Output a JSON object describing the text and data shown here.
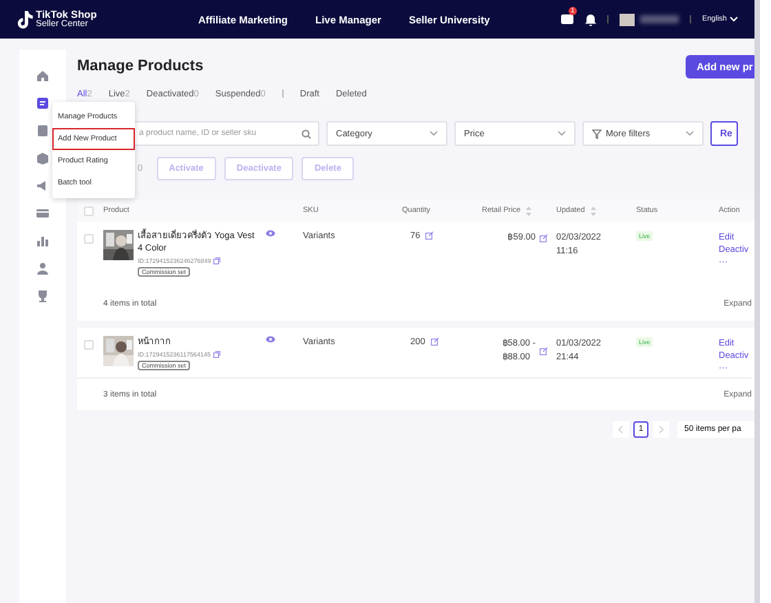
{
  "header": {
    "logo_line1": "TikTok Shop",
    "logo_line2": "Seller Center",
    "nav": [
      "Affiliate Marketing",
      "Live Manager",
      "Seller University"
    ],
    "message_badge": "1",
    "language": "English"
  },
  "sidebar": {
    "items": [
      {
        "selected": false
      },
      {
        "selected": true
      },
      {
        "selected": false
      },
      {
        "selected": false
      },
      {
        "selected": false
      },
      {
        "selected": false
      },
      {
        "selected": false
      },
      {
        "selected": false
      },
      {
        "selected": false
      }
    ]
  },
  "menu": {
    "items": [
      {
        "label": "Manage Products",
        "highlighted": false
      },
      {
        "label": "Add New Product",
        "highlighted": true
      },
      {
        "label": "Product Rating",
        "highlighted": false
      },
      {
        "label": "Batch tool",
        "highlighted": false
      }
    ]
  },
  "page": {
    "title": "Manage Products",
    "add_button": "Add new pr"
  },
  "tabs": [
    {
      "label": "All",
      "count": "2",
      "selected": true
    },
    {
      "label": "Live",
      "count": "2",
      "selected": false
    },
    {
      "label": "Deactivated",
      "count": "0",
      "selected": false
    },
    {
      "label": "Suspended",
      "count": "0",
      "selected": false
    },
    {
      "label": "Draft",
      "selected": false
    },
    {
      "label": "Deleted",
      "selected": false
    }
  ],
  "filters": {
    "search": {
      "placeholder": "a product name, ID or seller sku"
    },
    "selects": [
      {
        "kind": "plain",
        "label": "Category"
      },
      {
        "kind": "plain",
        "label": "Price"
      },
      {
        "kind": "filter",
        "label": "More filters"
      }
    ],
    "reset_button": "Re"
  },
  "bulk": {
    "selected_count": "0",
    "buttons": [
      {
        "label": "Activate",
        "disabled": true
      },
      {
        "label": "Deactivate",
        "disabled": true
      },
      {
        "label": "Delete",
        "disabled": true
      }
    ]
  },
  "table": {
    "select_all": {
      "checked": false
    },
    "columns": [
      {
        "label": "Product",
        "sortable": false
      },
      {
        "label": "SKU",
        "sortable": false
      },
      {
        "label": "Quantity",
        "sortable": false
      },
      {
        "label": "Retail Price",
        "sortable": true
      },
      {
        "label": "Updated",
        "sortable": true
      },
      {
        "label": "Status",
        "sortable": false
      },
      {
        "label": "Action",
        "sortable": false
      }
    ],
    "products": [
      {
        "checked": false,
        "name": "เสื้อสายเดี่ยวครึ่งตัว Yoga Vest 4 Color",
        "id": "ID:1729415236246276849",
        "commission": "Commission set",
        "sku": "Variants",
        "quantity": "76",
        "price": [
          "฿59.00"
        ],
        "updated": [
          "02/03/2022",
          "11:16"
        ],
        "status": "Live",
        "actions": [
          "Edit",
          "Deactiv",
          "···"
        ],
        "total": "4 items in total",
        "expand": "Expand"
      },
      {
        "checked": false,
        "name": "หน้ากาก",
        "id": "ID:1729415236117564145",
        "commission": "Commission set",
        "sku": "Variants",
        "quantity": "200",
        "price": [
          "฿58.00 -",
          "฿88.00"
        ],
        "updated": [
          "01/03/2022",
          "21:44"
        ],
        "status": "Live",
        "actions": [
          "Edit",
          "Deactiv",
          "···"
        ],
        "total": "3 items in total",
        "expand": "Expand"
      }
    ]
  },
  "pagination": {
    "pages": [
      {
        "label": "1",
        "selected": true
      }
    ],
    "per_page": "50 items per pa"
  }
}
